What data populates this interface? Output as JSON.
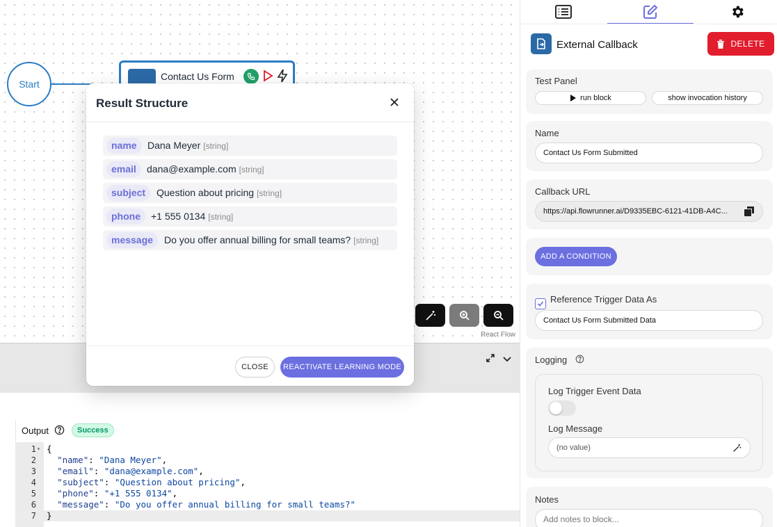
{
  "canvas": {
    "start_label": "Start",
    "node_title": "Contact Us Form",
    "attribution": "React Flow"
  },
  "modal": {
    "title": "Result Structure",
    "rows": [
      {
        "key": "name",
        "value": "Dana Meyer",
        "type": "[string]"
      },
      {
        "key": "email",
        "value": "dana@example.com",
        "type": "[string]"
      },
      {
        "key": "subject",
        "value": "Question about pricing",
        "type": "[string]"
      },
      {
        "key": "phone",
        "value": "+1 555 0134",
        "type": "[string]"
      },
      {
        "key": "message",
        "value": "Do you offer annual billing for small teams?",
        "type": "[string]"
      }
    ],
    "close_label": "CLOSE",
    "reactivate_label": "REACTIVATE LEARNING MODE"
  },
  "output": {
    "title": "Output",
    "status": "Success",
    "lines": [
      {
        "n": "1",
        "text": "{"
      },
      {
        "n": "2",
        "key": "\"name\"",
        "value": "\"Dana Meyer\""
      },
      {
        "n": "3",
        "key": "\"email\"",
        "value": "\"dana@example.com\""
      },
      {
        "n": "4",
        "key": "\"subject\"",
        "value": "\"Question about pricing\""
      },
      {
        "n": "5",
        "key": "\"phone\"",
        "value": "\"+1 555 0134\""
      },
      {
        "n": "6",
        "key": "\"message\"",
        "value": "\"Do you offer annual billing for small teams?\""
      },
      {
        "n": "7",
        "text": "}"
      }
    ]
  },
  "panel": {
    "tabs": [
      "list-icon",
      "edit-icon",
      "gear-icon"
    ],
    "block_title": "External Callback",
    "delete_label": "DELETE",
    "test_panel": {
      "label": "Test Panel",
      "run_label": "run block",
      "history_label": "show invocation history"
    },
    "name": {
      "label": "Name",
      "value": "Contact Us Form Submitted"
    },
    "callback": {
      "label": "Callback URL",
      "value": "https://api.flowrunner.ai/D9335EBC-6121-41DB-A4C..."
    },
    "condition_label": "ADD A CONDITION",
    "reference": {
      "label": "Reference Trigger Data As",
      "checked": true,
      "value": "Contact Us Form Submitted Data"
    },
    "logging": {
      "label": "Logging",
      "trigger_label": "Log Trigger Event Data",
      "message_label": "Log Message",
      "message_placeholder": "(no value)"
    },
    "notes": {
      "label": "Notes",
      "placeholder": "Add notes to block..."
    }
  },
  "colors": {
    "accent": "#6b6fe0",
    "delete": "#e11d2e",
    "node_blue": "#2b7cc4",
    "success": "#059669"
  }
}
